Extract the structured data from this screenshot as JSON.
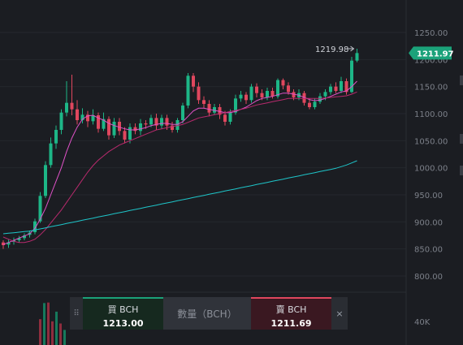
{
  "chart_data": {
    "type": "candlestick",
    "y_axis_ticks": [
      "1250.00",
      "1200.00",
      "1150.00",
      "1100.00",
      "1050.00",
      "1000.00",
      "950.00",
      "900.00",
      "850.00",
      "800.00"
    ],
    "y_range": [
      770,
      1275
    ],
    "volume_axis_tick": "40K",
    "annotation_high": "1219.98",
    "current_price": "1211.97",
    "candles": [
      [
        862,
        857,
        866,
        850
      ],
      [
        858,
        862,
        867,
        852
      ],
      [
        863,
        866,
        871,
        858
      ],
      [
        866,
        870,
        874,
        862
      ],
      [
        870,
        875,
        879,
        866
      ],
      [
        876,
        880,
        884,
        871
      ],
      [
        881,
        901,
        906,
        877
      ],
      [
        901,
        948,
        955,
        898
      ],
      [
        948,
        1005,
        1012,
        944
      ],
      [
        1005,
        1045,
        1056,
        1000
      ],
      [
        1045,
        1070,
        1078,
        1035
      ],
      [
        1070,
        1102,
        1108,
        1062
      ],
      [
        1102,
        1120,
        1160,
        1095
      ],
      [
        1120,
        1108,
        1172,
        1097
      ],
      [
        1108,
        1088,
        1125,
        1080
      ],
      [
        1088,
        1098,
        1110,
        1082
      ],
      [
        1098,
        1086,
        1105,
        1075
      ],
      [
        1086,
        1097,
        1108,
        1080
      ],
      [
        1097,
        1072,
        1102,
        1065
      ],
      [
        1072,
        1090,
        1102,
        1068
      ],
      [
        1090,
        1060,
        1095,
        1052
      ],
      [
        1060,
        1085,
        1092,
        1055
      ],
      [
        1085,
        1068,
        1092,
        1060
      ],
      [
        1068,
        1052,
        1075,
        1045
      ],
      [
        1052,
        1075,
        1082,
        1045
      ],
      [
        1075,
        1068,
        1082,
        1062
      ],
      [
        1068,
        1082,
        1090,
        1060
      ],
      [
        1082,
        1080,
        1088,
        1072
      ],
      [
        1080,
        1092,
        1098,
        1075
      ],
      [
        1092,
        1078,
        1100,
        1070
      ],
      [
        1078,
        1092,
        1098,
        1072
      ],
      [
        1092,
        1078,
        1098,
        1070
      ],
      [
        1078,
        1070,
        1085,
        1065
      ],
      [
        1070,
        1088,
        1092,
        1065
      ],
      [
        1088,
        1115,
        1120,
        1082
      ],
      [
        1115,
        1170,
        1175,
        1110
      ],
      [
        1170,
        1150,
        1175,
        1140
      ],
      [
        1150,
        1125,
        1158,
        1118
      ],
      [
        1125,
        1118,
        1132,
        1110
      ],
      [
        1118,
        1102,
        1125,
        1095
      ],
      [
        1102,
        1112,
        1118,
        1098
      ],
      [
        1112,
        1098,
        1118,
        1090
      ],
      [
        1098,
        1085,
        1105,
        1078
      ],
      [
        1085,
        1102,
        1108,
        1080
      ],
      [
        1102,
        1128,
        1135,
        1098
      ],
      [
        1128,
        1135,
        1142,
        1122
      ],
      [
        1135,
        1125,
        1140,
        1118
      ],
      [
        1125,
        1150,
        1155,
        1120
      ],
      [
        1150,
        1138,
        1156,
        1130
      ],
      [
        1138,
        1130,
        1145,
        1125
      ],
      [
        1130,
        1142,
        1148,
        1125
      ],
      [
        1142,
        1132,
        1148,
        1128
      ],
      [
        1132,
        1162,
        1165,
        1128
      ],
      [
        1162,
        1152,
        1165,
        1145
      ],
      [
        1152,
        1140,
        1158,
        1135
      ],
      [
        1140,
        1130,
        1145,
        1125
      ],
      [
        1130,
        1138,
        1145,
        1125
      ],
      [
        1138,
        1120,
        1142,
        1115
      ],
      [
        1120,
        1112,
        1128,
        1108
      ],
      [
        1112,
        1122,
        1128,
        1108
      ],
      [
        1122,
        1132,
        1138,
        1118
      ],
      [
        1132,
        1140,
        1145,
        1125
      ],
      [
        1140,
        1150,
        1155,
        1135
      ],
      [
        1150,
        1142,
        1158,
        1138
      ],
      [
        1142,
        1160,
        1168,
        1138
      ],
      [
        1160,
        1140,
        1165,
        1135
      ],
      [
        1140,
        1198,
        1205,
        1138
      ],
      [
        1198,
        1212,
        1220,
        1195
      ]
    ],
    "moving_averages": [
      {
        "color": "#e052c8",
        "values": [
          858,
          862,
          866,
          870,
          874,
          878,
          888,
          905,
          925,
          950,
          975,
          1000,
          1030,
          1055,
          1075,
          1090,
          1096,
          1097,
          1092,
          1088,
          1082,
          1078,
          1075,
          1072,
          1070,
          1070,
          1072,
          1074,
          1078,
          1080,
          1082,
          1082,
          1080,
          1080,
          1085,
          1095,
          1105,
          1110,
          1110,
          1108,
          1106,
          1104,
          1102,
          1102,
          1104,
          1108,
          1112,
          1118,
          1124,
          1128,
          1130,
          1132,
          1135,
          1138,
          1138,
          1136,
          1134,
          1130,
          1126,
          1124,
          1125,
          1128,
          1132,
          1136,
          1140,
          1142,
          1150,
          1160
        ]
      },
      {
        "color": "#b82a6d",
        "values": [
          872,
          868,
          864,
          862,
          862,
          864,
          868,
          876,
          886,
          898,
          910,
          922,
          936,
          950,
          964,
          978,
          992,
          1004,
          1014,
          1022,
          1030,
          1036,
          1042,
          1046,
          1050,
          1054,
          1058,
          1062,
          1066,
          1070,
          1072,
          1074,
          1076,
          1078,
          1080,
          1084,
          1088,
          1092,
          1094,
          1096,
          1098,
          1100,
          1102,
          1104,
          1106,
          1108,
          1110,
          1113,
          1116,
          1118,
          1120,
          1122,
          1124,
          1126,
          1128,
          1128,
          1128,
          1128,
          1128,
          1128,
          1128,
          1129,
          1130,
          1131,
          1132,
          1133,
          1136,
          1140
        ]
      },
      {
        "color": "#1ec5c9",
        "values": [
          878,
          879,
          880,
          881,
          882,
          883,
          885,
          887,
          889,
          891,
          893,
          895,
          897,
          899,
          901,
          903,
          905,
          907,
          909,
          911,
          913,
          915,
          917,
          919,
          921,
          923,
          925,
          927,
          929,
          931,
          933,
          935,
          937,
          939,
          941,
          943,
          945,
          947,
          949,
          951,
          953,
          955,
          957,
          959,
          961,
          963,
          965,
          967,
          969,
          971,
          973,
          975,
          977,
          979,
          981,
          983,
          985,
          987,
          989,
          991,
          993,
          995,
          997,
          999,
          1002,
          1005,
          1009,
          1013
        ]
      }
    ],
    "volumes": [
      {
        "v": 24000,
        "up": false
      },
      {
        "v": 39000,
        "up": true
      },
      {
        "v": 39500,
        "up": false
      },
      {
        "v": 22000,
        "up": false
      },
      {
        "v": 31000,
        "up": true
      },
      {
        "v": 20000,
        "up": false
      },
      {
        "v": 14000,
        "up": true
      }
    ],
    "colors": {
      "up": "#1db687",
      "down": "#e0475e",
      "tag": "#1ba27a"
    }
  },
  "trade_panel": {
    "drag_icon": "⠿",
    "buy_label": "買 BCH",
    "buy_price": "1213.00",
    "quantity_placeholder": "數量（BCH）",
    "sell_label": "賣 BCH",
    "sell_price": "1211.69",
    "close_icon": "×"
  }
}
